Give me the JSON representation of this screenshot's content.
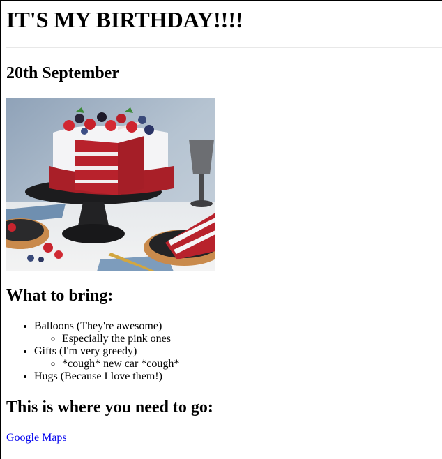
{
  "page": {
    "title": "IT'S MY BIRTHDAY!!!!",
    "date": "20th September"
  },
  "image": {
    "subject": "red velvet layer cake with berries on a black cake stand",
    "colors": {
      "frosting": "#f4f4f6",
      "sponge": "#b8222c",
      "stand": "#1c1c1e",
      "background": "#a9b7c6",
      "plate_wood": "#c9874a"
    }
  },
  "bring": {
    "heading": "What to bring:",
    "items": [
      {
        "label": "Balloons (They're awesome)",
        "sub": "Especially the pink ones"
      },
      {
        "label": "Gifts (I'm very greedy)",
        "sub": "*cough* new car *cough*"
      },
      {
        "label": "Hugs (Because I love them!)"
      }
    ]
  },
  "location": {
    "heading": "This is where you need to go:",
    "link_label": "Google Maps"
  }
}
